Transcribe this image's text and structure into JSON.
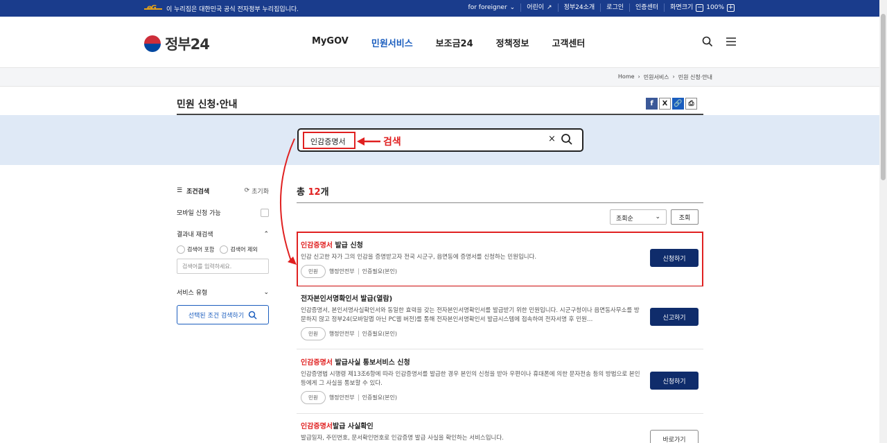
{
  "topbar": {
    "notice": "이 누리집은 대한민국 공식 전자정부 누리집입니다.",
    "links": [
      "for foreigner",
      "어린이",
      "정부24소개",
      "로그인",
      "인증센터"
    ],
    "zoom_label": "화면크기",
    "zoom_value": "100%"
  },
  "header": {
    "logo_text": "정부24",
    "nav": [
      "MyGOV",
      "민원서비스",
      "보조금24",
      "정책정보",
      "고객센터"
    ]
  },
  "breadcrumb": [
    "Home",
    "민원서비스",
    "민원 신청·안내"
  ],
  "page": {
    "title": "민원 신청·안내"
  },
  "search": {
    "value": "인감증명서",
    "annotation": "검색"
  },
  "sidebar": {
    "filter_title": "조건검색",
    "reset": "초기화",
    "mobile": "모바일 신청 가능",
    "refine_title": "결과내 재검색",
    "include": "검색어 포함",
    "exclude": "검색어 제외",
    "refine_placeholder": "검색어를 입력하세요.",
    "service_type": "서비스 유형",
    "search_btn": "선택된 조건 검색하기"
  },
  "results": {
    "total_prefix": "총",
    "total_count": "12",
    "total_suffix": "개",
    "sort": "조회순",
    "sort_btn": "조회",
    "items": [
      {
        "hl": "인감증명서",
        "title": " 발급 신청",
        "desc": "인감 신고한 자가 그의 인감을 증명받고자 전국 시군구, 읍면동에 증명서를 신청하는 민원입니다.",
        "tag": "민원",
        "org": "행정안전부",
        "auth": "인증필요(본인)",
        "action": "신청하기"
      },
      {
        "hl": "",
        "title": "전자본인서명확인서 발급(열람)",
        "desc": "인감증명서, 본인서명사실확인서와 동일한 효력을 갖는 전자본인서명확인서를 발급받기 위한 민원입니다. 시군구청이나 읍면동사무소를 방문하지 않고 정부24(모바일앱 아닌 PC웹 버전)를 통해 전자본인서명확인서 발급시스템에 접속하여 전자서명 후 민원…",
        "tag": "민원",
        "org": "행정안전부",
        "auth": "인증필요(본인)",
        "action": "신고하기"
      },
      {
        "hl": "인감증명서",
        "title": " 발급사실 통보서비스 신청",
        "desc": "인감증명법 시행령 제13조6항에 따라 인감증명서를 발급한 경우 본인의 신청을 받아 우편이나 휴대폰에 의한 문자전송 등의 방법으로 본인 등에게 그 사실을 통보할 수 있다.",
        "tag": "민원",
        "org": "행정안전부",
        "auth": "인증필요(본인)",
        "action": "신청하기"
      },
      {
        "hl": "인감증명서",
        "title": "발급 사실확인",
        "desc": "발급일자, 주민번호, 문서확인번호로 인감증명 발급 사실을 확인하는 서비스입니다.",
        "tag": "",
        "org": "",
        "auth": "",
        "action": "바로가기"
      }
    ]
  }
}
